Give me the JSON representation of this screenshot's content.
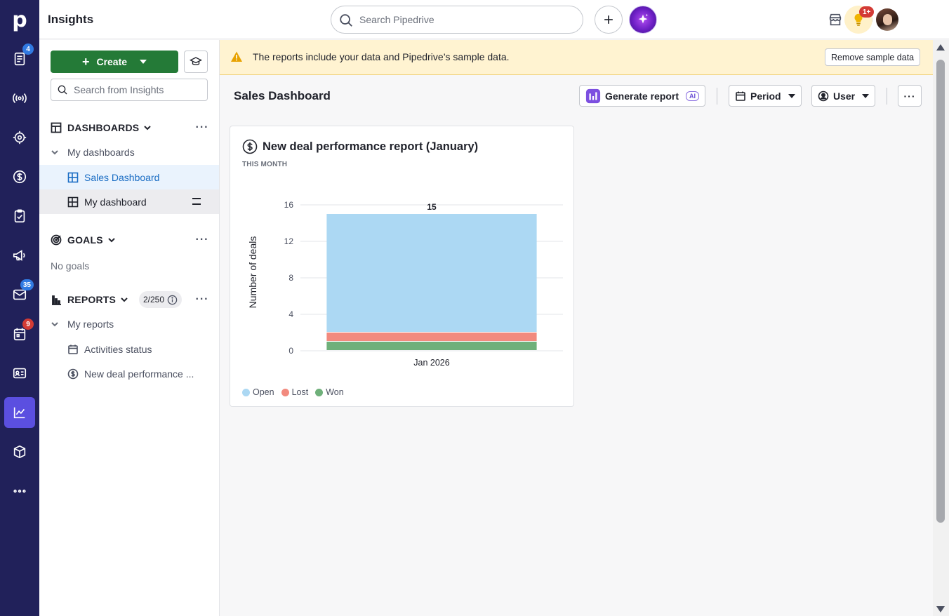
{
  "app": {
    "title": "Insights",
    "logo_letter": "p"
  },
  "topbar": {
    "search_placeholder": "Search Pipedrive",
    "notification_badge": "1+"
  },
  "rail": {
    "items": [
      {
        "icon": "leads-icon",
        "badge": "4"
      },
      {
        "icon": "broadcast-icon"
      },
      {
        "icon": "target-icon"
      },
      {
        "icon": "deals-dollar-icon"
      },
      {
        "icon": "tasks-clipboard-icon"
      },
      {
        "icon": "campaigns-megaphone-icon"
      },
      {
        "icon": "mail-icon",
        "badge": "35"
      },
      {
        "icon": "calendar-icon",
        "badge": "9"
      },
      {
        "icon": "contacts-card-icon"
      },
      {
        "icon": "insights-chart-icon",
        "active": true
      },
      {
        "icon": "products-box-icon"
      },
      {
        "icon": "more-dots-icon"
      }
    ]
  },
  "sidebar": {
    "create_label": "Create",
    "search_placeholder": "Search from Insights",
    "dashboards": {
      "heading": "DASHBOARDS",
      "group_label": "My dashboards",
      "items": [
        "Sales Dashboard",
        "My dashboard"
      ]
    },
    "goals": {
      "heading": "GOALS",
      "empty_text": "No goals"
    },
    "reports": {
      "heading": "REPORTS",
      "quota": "2/250",
      "group_label": "My reports",
      "items": [
        "Activities status",
        "New deal performance ..."
      ]
    }
  },
  "banner": {
    "text": "The reports include your data and Pipedrive’s sample data.",
    "button_label": "Remove sample data"
  },
  "dashboard": {
    "title": "Sales Dashboard",
    "generate_label": "Generate report",
    "ai_tag": "AI",
    "period_label": "Period",
    "user_label": "User"
  },
  "report_card": {
    "title": "New deal performance report (January)",
    "subtitle": "THIS MONTH"
  },
  "chart_data": {
    "type": "bar",
    "stacked": true,
    "categories": [
      "Jan 2026"
    ],
    "ylabel": "Number of deals",
    "xlabel": "",
    "ylim": [
      0,
      16
    ],
    "yticks": [
      0,
      4,
      8,
      12,
      16
    ],
    "total_labels": [
      "15"
    ],
    "series": [
      {
        "name": "Won",
        "values": [
          1
        ],
        "color": "#6fb07a"
      },
      {
        "name": "Lost",
        "values": [
          1
        ],
        "color": "#f28a7e"
      },
      {
        "name": "Open",
        "values": [
          13
        ],
        "color": "#acd8f3"
      }
    ],
    "legend_order": [
      "Open",
      "Lost",
      "Won"
    ],
    "grid": true,
    "legend_position": "bottom-left"
  }
}
